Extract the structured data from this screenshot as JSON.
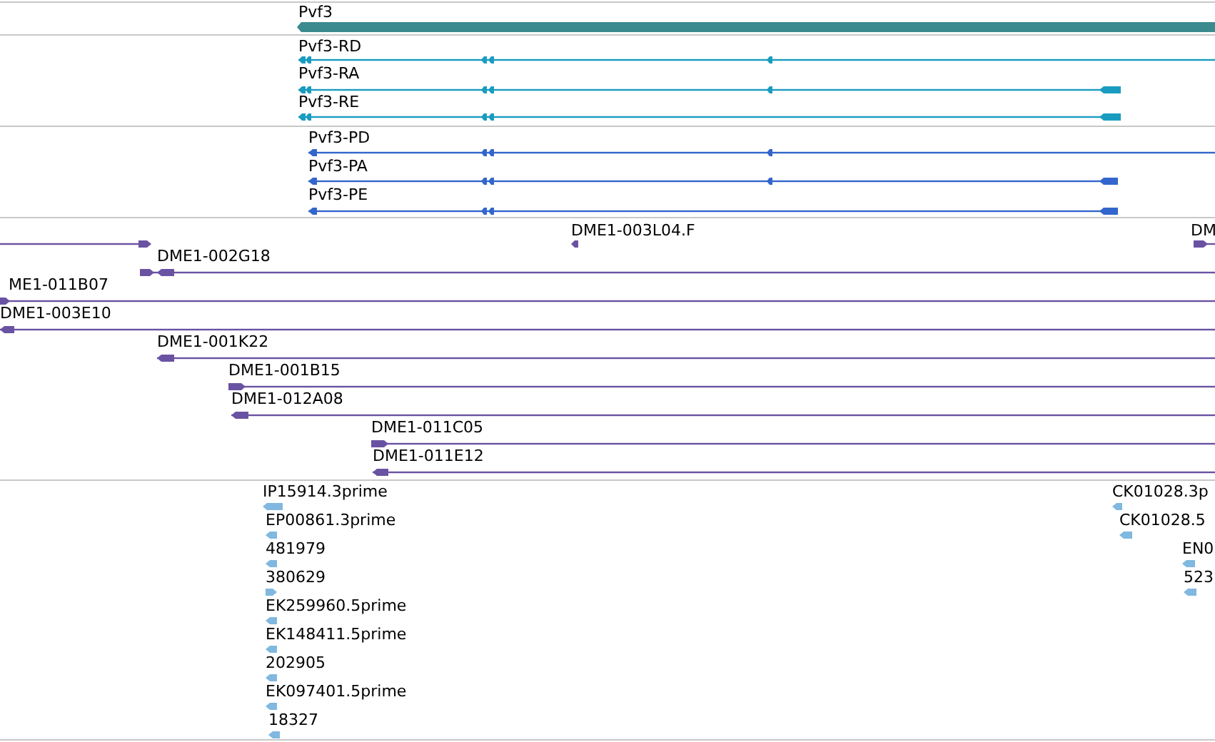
{
  "tracks": [
    {
      "kind": "gene",
      "color": "#3a8a8e",
      "features": [
        {
          "label": "Pvf3",
          "reverse": true
        }
      ]
    },
    {
      "kind": "transcript",
      "color": "#1a9cc0",
      "features": [
        {
          "label": "Pvf3-RD",
          "reverse": true
        },
        {
          "label": "Pvf3-RA",
          "reverse": true
        },
        {
          "label": "Pvf3-RE",
          "reverse": true
        }
      ]
    },
    {
      "kind": "protein",
      "color": "#3366cc",
      "features": [
        {
          "label": "Pvf3-PD",
          "reverse": true
        },
        {
          "label": "Pvf3-PA",
          "reverse": true
        },
        {
          "label": "Pvf3-PE",
          "reverse": true
        }
      ]
    },
    {
      "kind": "clone",
      "color": "#6a52a3",
      "features": [
        {
          "reverse": false
        },
        {
          "label": "DME1-003L04.F",
          "reverse": true
        },
        {
          "label": "DM",
          "reverse": false
        },
        {
          "label": "DME1-002G18",
          "reverse": true
        },
        {
          "label": "ME1-011B07",
          "reverse": false
        },
        {
          "label": "DME1-003E10",
          "reverse": true
        },
        {
          "label": "DME1-001K22",
          "reverse": true
        },
        {
          "label": "DME1-001B15",
          "reverse": false
        },
        {
          "label": "DME1-012A08",
          "reverse": true
        },
        {
          "label": "DME1-011C05",
          "reverse": false
        },
        {
          "label": "DME1-011E12",
          "reverse": true
        }
      ]
    },
    {
      "kind": "est",
      "color": "#80b8e0",
      "features": [
        {
          "label": "IP15914.3prime",
          "reverse": true
        },
        {
          "label": "EP00861.3prime",
          "reverse": true
        },
        {
          "label": "481979",
          "reverse": true
        },
        {
          "label": "380629",
          "reverse": false
        },
        {
          "label": "EK259960.5prime",
          "reverse": true
        },
        {
          "label": "EK148411.5prime",
          "reverse": true
        },
        {
          "label": "202905",
          "reverse": true
        },
        {
          "label": "EK097401.5prime",
          "reverse": true
        },
        {
          "label": "18327",
          "reverse": true
        },
        {
          "label": "CK01028.3p",
          "reverse": true
        },
        {
          "label": "CK01028.5",
          "reverse": true
        },
        {
          "label": "EN0",
          "reverse": true
        },
        {
          "label": "523",
          "reverse": true
        }
      ]
    }
  ]
}
